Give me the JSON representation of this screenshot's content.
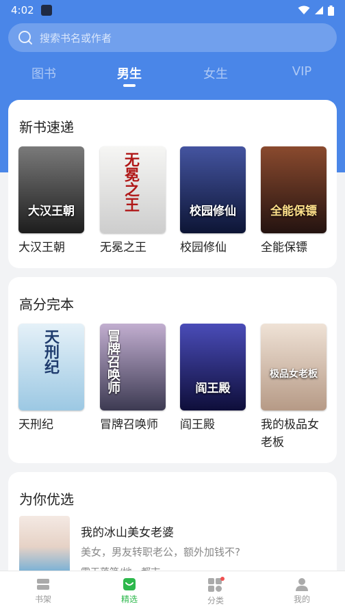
{
  "status_bar": {
    "time": "4:02"
  },
  "search": {
    "placeholder": "搜索书名或作者"
  },
  "tabs": [
    {
      "label": "图书"
    },
    {
      "label": "男生"
    },
    {
      "label": "女生"
    },
    {
      "label": "VIP"
    }
  ],
  "active_tab": "男生",
  "sections": {
    "new_books": {
      "title": "新书速递",
      "books": [
        {
          "title": "大汉王朝",
          "cover_text": "大汉王朝",
          "cover_colors": [
            "#6d6d6d",
            "#1d1d1d"
          ]
        },
        {
          "title": "无冕之王",
          "cover_text": "无冕之王",
          "cover_colors": [
            "#f3f3f1",
            "#cfcfcf"
          ]
        },
        {
          "title": "校园修仙",
          "cover_text": "校园修仙",
          "cover_colors": [
            "#3d4b8f",
            "#0d1535"
          ]
        },
        {
          "title": "全能保镖",
          "cover_text": "全能保镖",
          "cover_colors": [
            "#8a4a2e",
            "#241310"
          ]
        }
      ]
    },
    "high_score": {
      "title": "高分完本",
      "books": [
        {
          "title": "天刑纪",
          "cover_text": "天刑纪",
          "cover_colors": [
            "#dfeef7",
            "#9cc8e3"
          ]
        },
        {
          "title": "冒牌召唤师",
          "cover_text": "冒牌召唤师",
          "cover_colors": [
            "#b9a6c7",
            "#3c3a52"
          ]
        },
        {
          "title": "阎王殿",
          "cover_text": "阎王殿",
          "cover_colors": [
            "#3d3fa8",
            "#0e0e3a"
          ]
        },
        {
          "title": "我的极品女老板",
          "cover_text": "极品女老板",
          "cover_colors": [
            "#efe2d6",
            "#b69a86"
          ]
        }
      ]
    },
    "recommended": {
      "title": "为你优选",
      "item": {
        "title": "我的冰山美女老婆",
        "description": "美女，男友转职老公，额外加钱不?",
        "meta": "霜天落笔/地 · 都市"
      }
    }
  },
  "bottom_nav": [
    {
      "label": "书架",
      "icon": "bookshelf-icon"
    },
    {
      "label": "精选",
      "icon": "featured-icon"
    },
    {
      "label": "分类",
      "icon": "category-icon"
    },
    {
      "label": "我的",
      "icon": "profile-icon"
    }
  ],
  "colors": {
    "header_blue": "#4a86e8",
    "active_green": "#2db84c",
    "badge_red": "#f05050"
  }
}
